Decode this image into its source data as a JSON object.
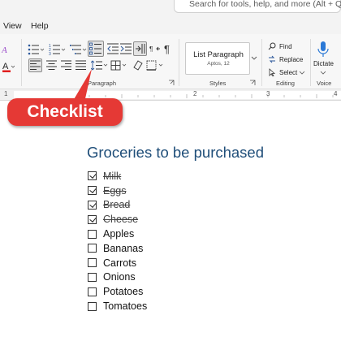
{
  "search": {
    "placeholder": "Search for tools, help, and more (Alt + Q)"
  },
  "tabs": [
    {
      "label": "View"
    },
    {
      "label": "Help"
    }
  ],
  "ribbon": {
    "paragraph_label": "Paragraph",
    "styles": {
      "current_style": "List Paragraph",
      "current_font": "Aptos, 12",
      "group_label": "Styles"
    },
    "editing": {
      "find_label": "Find",
      "replace_label": "Replace",
      "select_label": "Select",
      "group_label": "Editing"
    },
    "voice": {
      "dictate_label": "Dictate",
      "group_label": "Voice"
    }
  },
  "ruler": {
    "numbers": [
      "1",
      "2",
      "3",
      "4"
    ]
  },
  "callout": {
    "label": "Checklist"
  },
  "colors": {
    "callout": "#e53935",
    "title": "#1f4e79"
  },
  "document": {
    "title": "Groceries to be purchased",
    "items": [
      {
        "text": "Milk",
        "checked": true
      },
      {
        "text": "Eggs",
        "checked": true
      },
      {
        "text": "Bread",
        "checked": true
      },
      {
        "text": "Cheese",
        "checked": true
      },
      {
        "text": "Apples",
        "checked": false
      },
      {
        "text": "Bananas",
        "checked": false
      },
      {
        "text": "Carrots",
        "checked": false
      },
      {
        "text": "Onions",
        "checked": false
      },
      {
        "text": "Potatoes",
        "checked": false
      },
      {
        "text": "Tomatoes",
        "checked": false
      }
    ]
  }
}
